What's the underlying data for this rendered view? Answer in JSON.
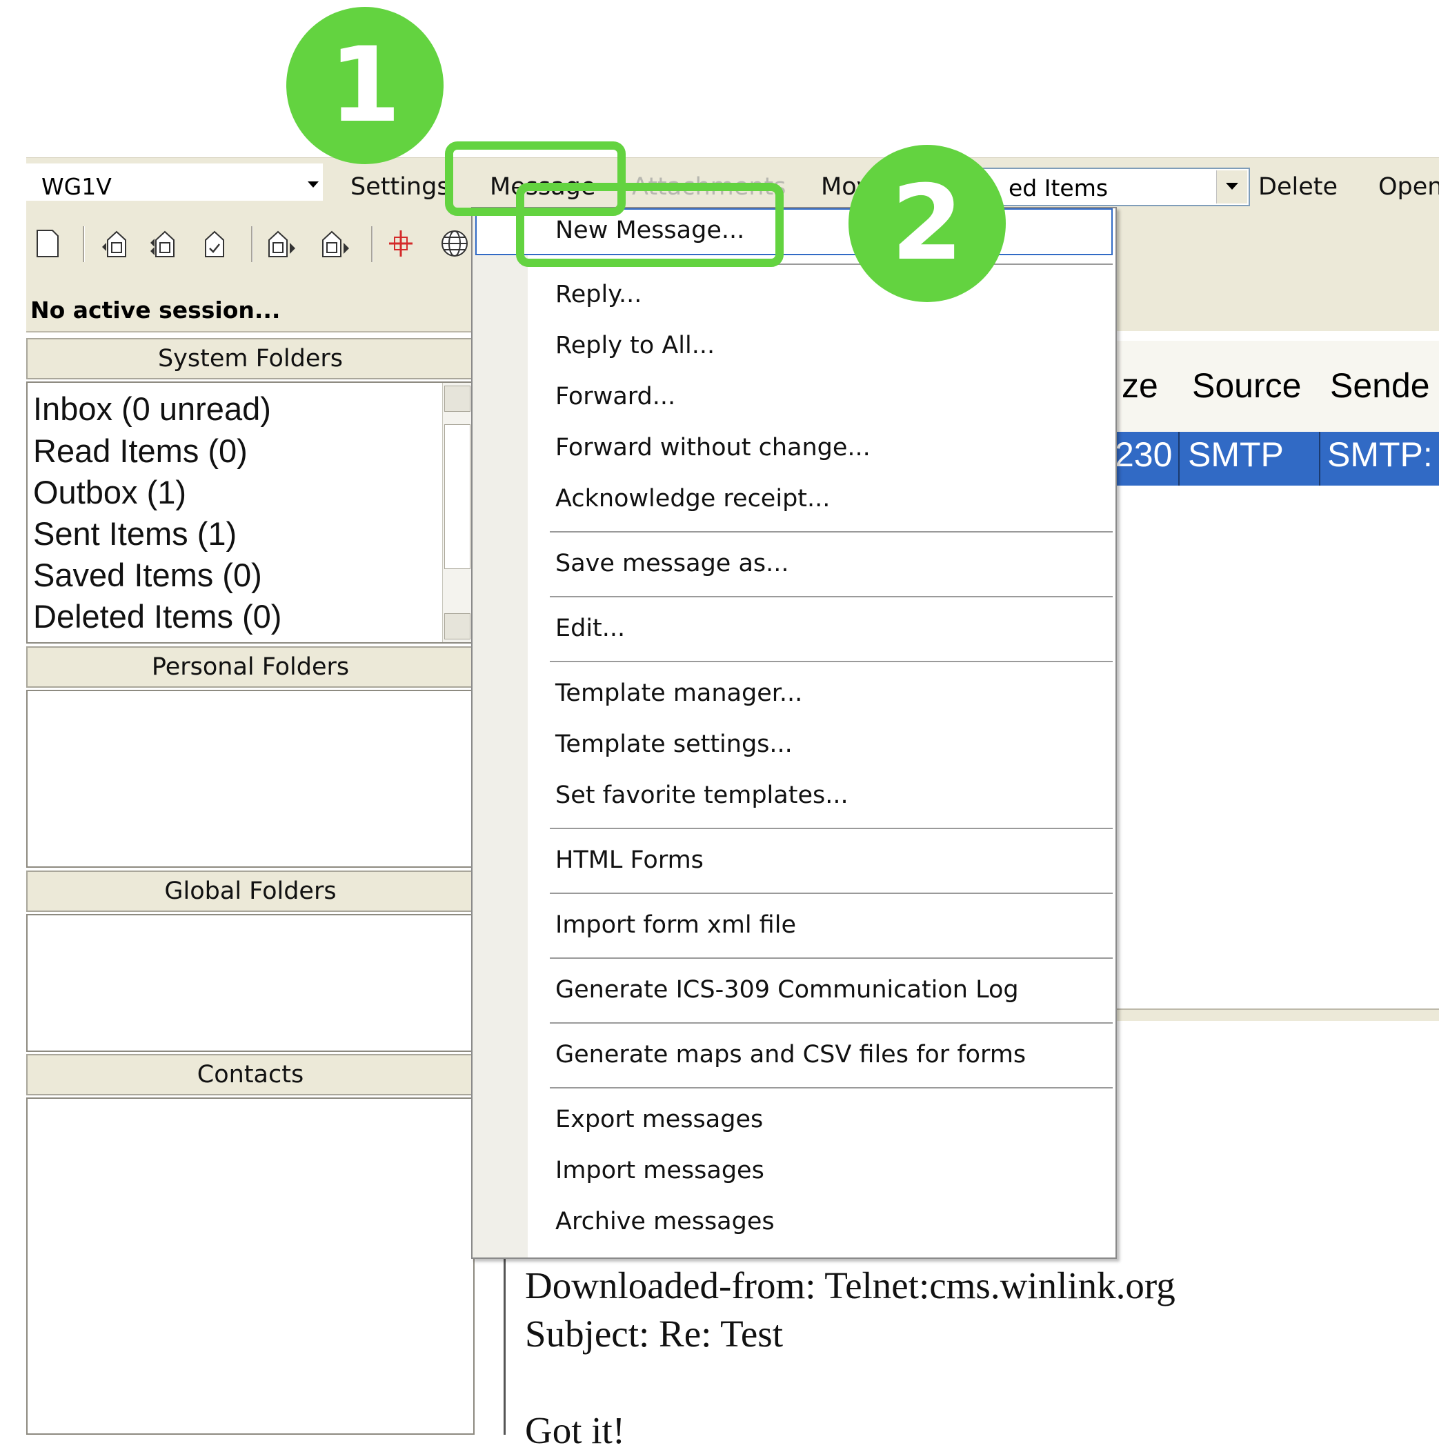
{
  "menubar": {
    "account_value": "WG1V",
    "settings_label": "Settings",
    "message_label": "Message",
    "attachments_label": "Attachments",
    "move_label_partial": "Mov",
    "move_target_partial": "ed Items",
    "delete_label": "Delete",
    "open_label_partial": "Open"
  },
  "status": {
    "text": "No active session..."
  },
  "system_folders": {
    "title": "System Folders",
    "items": [
      {
        "label": "Inbox  (0 unread)"
      },
      {
        "label": "Read Items  (0)"
      },
      {
        "label": "Outbox  (1)"
      },
      {
        "label": "Sent Items  (1)"
      },
      {
        "label": "Saved Items  (0)"
      },
      {
        "label": "Deleted Items  (0)"
      }
    ]
  },
  "personal_folders": {
    "title": "Personal Folders"
  },
  "global_folders": {
    "title": "Global Folders"
  },
  "contacts": {
    "title": "Contacts"
  },
  "message_list": {
    "columns": [
      "ze",
      "Source",
      "Sende"
    ],
    "row": {
      "size": "230",
      "source": "SMTP",
      "sender": "SMTP:"
    }
  },
  "preview": {
    "lines": [
      "Downloaded-from: Telnet:cms.winlink.org",
      "Subject: Re: Test",
      "Got it!"
    ]
  },
  "message_menu": {
    "items": [
      "New Message...",
      "Reply...",
      "Reply to All...",
      "Forward...",
      "Forward without change...",
      "Acknowledge receipt...",
      "Save message as...",
      "Edit...",
      "Template manager...",
      "Template settings...",
      "Set favorite templates...",
      "HTML Forms",
      "Import form xml file",
      "Generate ICS-309 Communication Log",
      "Generate maps and CSV files for forms",
      "Export messages",
      "Import messages",
      "Archive messages"
    ]
  },
  "annotations": {
    "step1": "1",
    "step2": "2",
    "accent_color": "#63d340"
  },
  "colors": {
    "selection": "#316ac5",
    "chrome": "#ece9d8"
  }
}
